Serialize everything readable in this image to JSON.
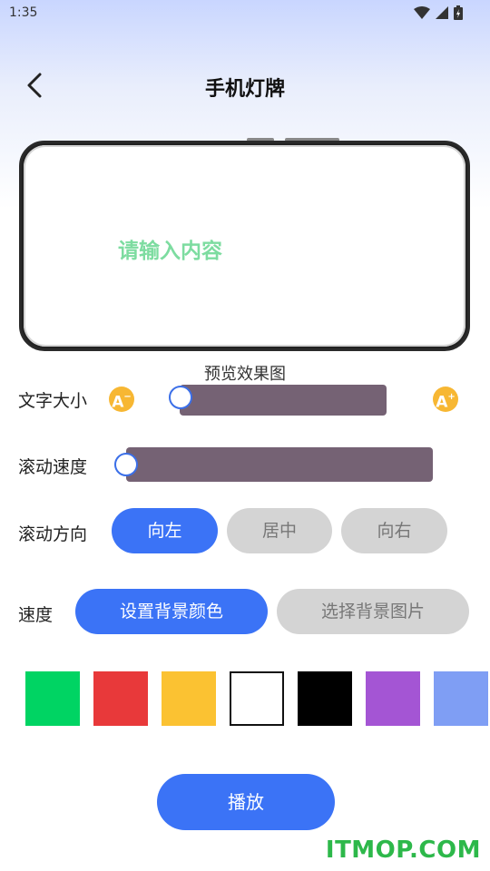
{
  "status_bar": {
    "time": "1:35"
  },
  "header": {
    "title": "手机灯牌"
  },
  "preview": {
    "text": "请输入内容",
    "caption": "预览效果图"
  },
  "font_size": {
    "label": "文字大小",
    "min_icon": "A-",
    "max_icon": "A+",
    "level": 0.0
  },
  "scroll_speed": {
    "label": "滚动速度",
    "level": 0.0
  },
  "direction": {
    "label": "滚动方向",
    "options": [
      "向左",
      "居中",
      "向右"
    ],
    "selected": "向左"
  },
  "background": {
    "label": "速度",
    "color_button": "设置背景颜色",
    "image_button": "选择背景图片",
    "selected": "设置背景颜色"
  },
  "swatches": [
    "#00d463",
    "#e8393a",
    "#fbc232",
    "#ffffff",
    "#000000",
    "#a455d4",
    "#7f9ef4"
  ],
  "play_button": "播放",
  "watermark": "ITMOP.COM",
  "colors": {
    "accent": "#3b73f6",
    "track": "#756274",
    "preview_text": "#7ddca0"
  }
}
